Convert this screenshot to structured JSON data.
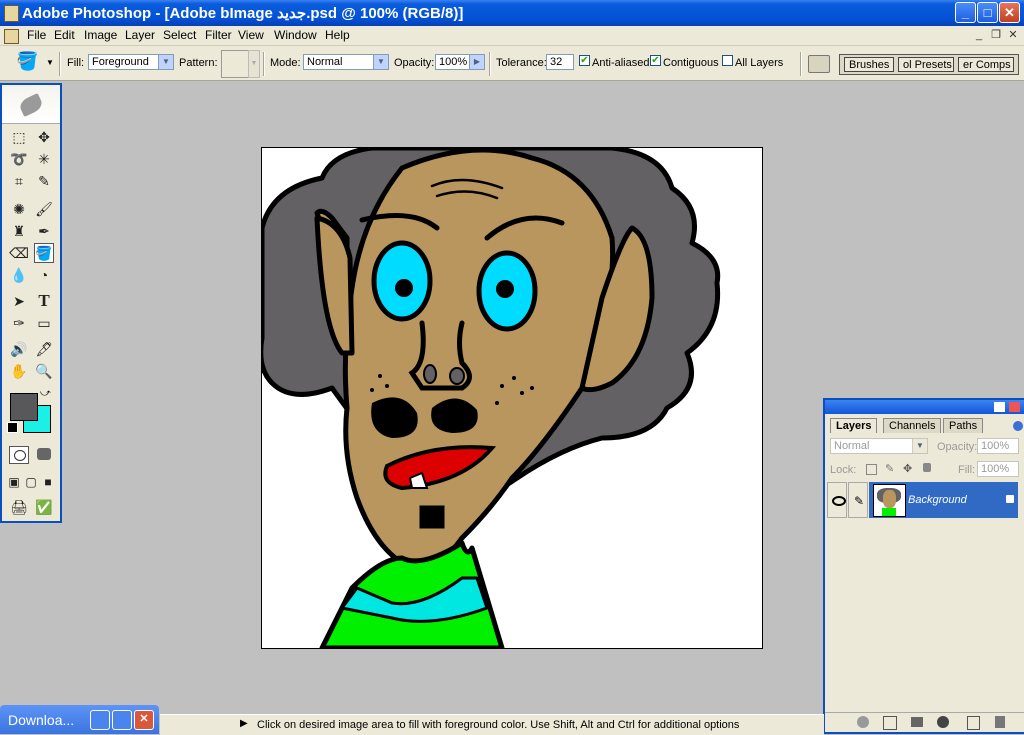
{
  "window": {
    "title": "Adobe Photoshop - [Adobe bImage جديد.psd @ 100% (RGB/8)]",
    "controls": {
      "minimize": "_",
      "maximize": "□",
      "close": "✕"
    }
  },
  "menu": [
    "File",
    "Edit",
    "Image",
    "Layer",
    "Select",
    "Filter",
    "View",
    "Window",
    "Help"
  ],
  "mdi_controls": {
    "minimize": "_",
    "restore": "❐",
    "close": "✕"
  },
  "options": {
    "fill_label": "Fill:",
    "fill_value": "Foreground",
    "pattern_label": "Pattern:",
    "mode_label": "Mode:",
    "mode_value": "Normal",
    "opacity_label": "Opacity:",
    "opacity_value": "100%",
    "tolerance_label": "Tolerance:",
    "tolerance_value": "32",
    "anti_aliased_label": "Anti-aliased",
    "anti_aliased": true,
    "contiguous_label": "Contiguous",
    "contiguous": true,
    "all_layers_label": "All Layers",
    "all_layers": false,
    "well_tabs": [
      "Brushes",
      "ol Presets",
      "er Comps"
    ]
  },
  "layers_panel": {
    "tabs": [
      "Layers",
      "Channels",
      "Paths"
    ],
    "blend_mode": "Normal",
    "opacity_label": "Opacity:",
    "opacity_value": "100%",
    "lock_label": "Lock:",
    "fill_label": "Fill:",
    "fill_value": "100%",
    "layer_name": "Background"
  },
  "status": {
    "text": "Click on desired image area to fill with foreground color.  Use Shift, Alt and Ctrl for additional options"
  },
  "taskbar": {
    "label": "Downloa..."
  },
  "colors": {
    "title_blue": "#0552d6",
    "foreground_color": "#58585a",
    "background_color": "#1cf0e6",
    "skin": "#b8965e",
    "hair": "#636163",
    "eyes": "#00dcff",
    "shirt": "#00f000",
    "collar": "#00e6e0",
    "lips": "#dc0000"
  }
}
